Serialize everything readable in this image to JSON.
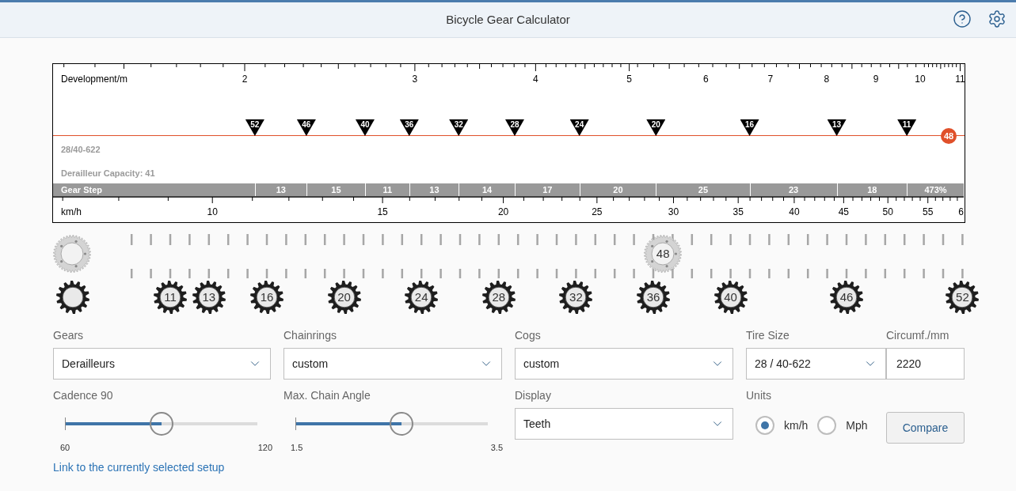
{
  "header": {
    "title": "Bicycle Gear Calculator"
  },
  "chart": {
    "top_axis": {
      "label": "Development/m",
      "ticks": [
        "2",
        "3",
        "4",
        "5",
        "6",
        "7",
        "8",
        "9",
        "10",
        "11"
      ]
    },
    "markers": [
      {
        "label": "52"
      },
      {
        "label": "46"
      },
      {
        "label": "40"
      },
      {
        "label": "36"
      },
      {
        "label": "32"
      },
      {
        "label": "28"
      },
      {
        "label": "24"
      },
      {
        "label": "20"
      },
      {
        "label": "16"
      },
      {
        "label": "13"
      },
      {
        "label": "11"
      }
    ],
    "chainring": {
      "label": "48"
    },
    "info": [
      "28/40-622",
      "Derailleur Capacity: 41"
    ],
    "gear_step": {
      "label": "Gear Step",
      "values": [
        "13",
        "15",
        "11",
        "13",
        "14",
        "17",
        "20",
        "25",
        "23",
        "18",
        "473%"
      ]
    },
    "bottom_axis": {
      "label": "km/h",
      "ticks": [
        {
          "label": "10",
          "clipped": false
        },
        {
          "label": "15",
          "clipped": false
        },
        {
          "label": "20",
          "clipped": false
        },
        {
          "label": "25",
          "clipped": false
        },
        {
          "label": "30",
          "clipped": false
        },
        {
          "label": "35",
          "clipped": false
        },
        {
          "label": "40",
          "clipped": false
        },
        {
          "label": "45",
          "clipped": false
        },
        {
          "label": "50",
          "clipped": false
        },
        {
          "label": "55",
          "clipped": false
        },
        {
          "label": "6",
          "clipped": true
        }
      ]
    }
  },
  "gears": {
    "chainrings": [
      {
        "teeth": "48"
      }
    ],
    "cogs": [
      {
        "teeth": "11"
      },
      {
        "teeth": "13"
      },
      {
        "teeth": "16"
      },
      {
        "teeth": "20"
      },
      {
        "teeth": "24"
      },
      {
        "teeth": "28"
      },
      {
        "teeth": "32"
      },
      {
        "teeth": "36"
      },
      {
        "teeth": "40"
      },
      {
        "teeth": "46"
      },
      {
        "teeth": "52"
      }
    ]
  },
  "form": {
    "gears": {
      "label": "Gears",
      "value": "Derailleurs"
    },
    "chainrings": {
      "label": "Chainrings",
      "value": "custom"
    },
    "cogs": {
      "label": "Cogs",
      "value": "custom"
    },
    "tire_size": {
      "label": "Tire Size",
      "value": "28 / 40-622"
    },
    "circumference": {
      "label": "Circumf./mm",
      "value": "2220"
    },
    "cadence": {
      "label": "Cadence 90",
      "level": 0.5,
      "min": "60",
      "max": "120"
    },
    "chain_angle": {
      "label": "Max. Chain Angle",
      "level": 0.55,
      "min": "1.5",
      "max": "3.5"
    },
    "display": {
      "label": "Display",
      "value": "Teeth"
    },
    "units": {
      "label": "Units",
      "options": [
        {
          "label": "km/h",
          "selected": true
        },
        {
          "label": "Mph",
          "selected": false
        }
      ]
    },
    "compare": "Compare",
    "link": "Link to the currently selected setup"
  }
}
